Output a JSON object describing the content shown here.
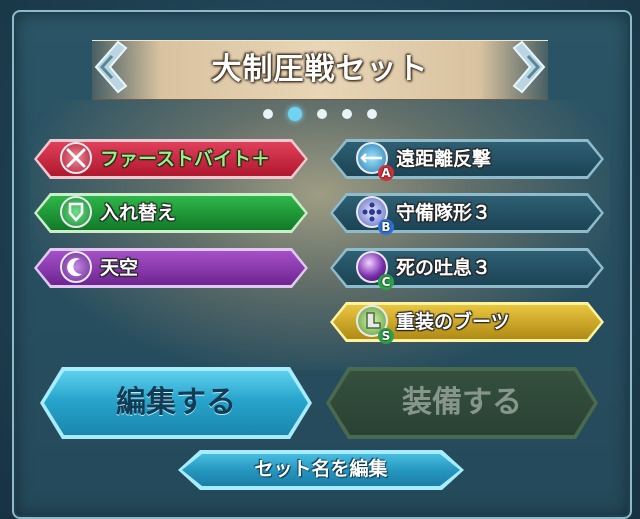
{
  "header": {
    "title": "大制圧戦セット"
  },
  "pager": {
    "count": 5,
    "active_index": 0
  },
  "skills_left": [
    {
      "label": "ファーストバイト＋",
      "kind": "weapon",
      "color": "red",
      "icon": "crossed-swords-icon"
    },
    {
      "label": "入れ替え",
      "kind": "assist",
      "color": "green",
      "icon": "shield-icon"
    },
    {
      "label": "天空",
      "kind": "special",
      "color": "purple",
      "icon": "crescent-moon-icon"
    }
  ],
  "skills_right": [
    {
      "label": "遠距離反撃",
      "badge": "A",
      "color": "teal",
      "icon": "counter-arrow-icon"
    },
    {
      "label": "守備隊形３",
      "badge": "B",
      "color": "teal",
      "icon": "formation-icon"
    },
    {
      "label": "死の吐息３",
      "badge": "C",
      "color": "teal",
      "icon": "dark-breath-icon"
    },
    {
      "label": "重装のブーツ",
      "badge": "S",
      "color": "gold",
      "icon": "armored-boots-icon"
    }
  ],
  "buttons": {
    "edit": "編集する",
    "equip": "装備する",
    "rename": "セット名を編集"
  },
  "colors": {
    "accent": "#6fd3f2",
    "badge_a": "#d0303a",
    "badge_b": "#3070d8",
    "badge_c": "#2ea04a",
    "badge_s": "#2ea04a"
  }
}
